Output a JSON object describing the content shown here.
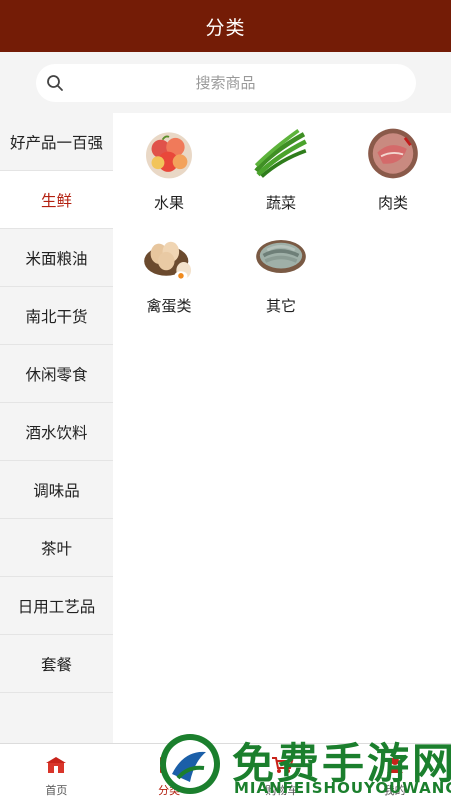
{
  "header": {
    "title": "分类"
  },
  "search": {
    "placeholder": "搜索商品"
  },
  "sidebar": {
    "items": [
      {
        "label": "好产品一百强",
        "active": false
      },
      {
        "label": "生鲜",
        "active": true
      },
      {
        "label": "米面粮油",
        "active": false
      },
      {
        "label": "南北干货",
        "active": false
      },
      {
        "label": "休闲零食",
        "active": false
      },
      {
        "label": "酒水饮料",
        "active": false
      },
      {
        "label": "调味品",
        "active": false
      },
      {
        "label": "茶叶",
        "active": false
      },
      {
        "label": "日用工艺品",
        "active": false
      },
      {
        "label": "套餐",
        "active": false
      }
    ]
  },
  "categories": [
    {
      "label": "水果",
      "icon": "fruit-icon"
    },
    {
      "label": "蔬菜",
      "icon": "vegetable-icon"
    },
    {
      "label": "肉类",
      "icon": "meat-icon"
    },
    {
      "label": "禽蛋类",
      "icon": "egg-icon"
    },
    {
      "label": "其它",
      "icon": "shrimp-icon"
    }
  ],
  "tabbar": {
    "items": [
      {
        "label": "首页",
        "icon": "home-icon"
      },
      {
        "label": "分类",
        "icon": "category-icon",
        "active": true
      },
      {
        "label": "购物车",
        "icon": "cart-icon"
      },
      {
        "label": "我的",
        "icon": "profile-icon"
      }
    ]
  },
  "watermark": {
    "title": "免费手游网",
    "subtitle": "MIANFEISHOUYOUWANG"
  },
  "colors": {
    "brand": "#741c06",
    "active_text": "#b32010",
    "watermark": "#1b7f2d"
  }
}
